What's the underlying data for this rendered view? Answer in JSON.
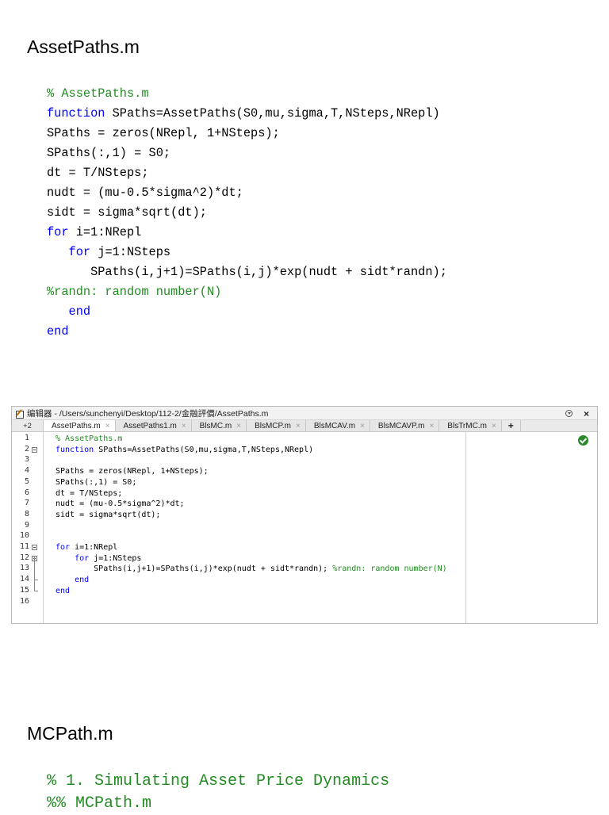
{
  "section1": {
    "heading": "AssetPaths.m"
  },
  "code1": [
    [
      {
        "t": "% AssetPaths.m",
        "c": "comment"
      }
    ],
    [
      {
        "t": "function",
        "c": "keyword"
      },
      {
        "t": " SPaths=AssetPaths(S0,mu,sigma,T,NSteps,NRepl)",
        "c": "plain"
      }
    ],
    [
      {
        "t": "SPaths = zeros(NRepl, 1+NSteps);",
        "c": "plain"
      }
    ],
    [
      {
        "t": "SPaths(:,1) = S0;",
        "c": "plain"
      }
    ],
    [
      {
        "t": "dt = T/NSteps;",
        "c": "plain"
      }
    ],
    [
      {
        "t": "nudt = (mu-0.5*sigma^2)*dt;",
        "c": "plain"
      }
    ],
    [
      {
        "t": "sidt = sigma*sqrt(dt);",
        "c": "plain"
      }
    ],
    [
      {
        "t": "for",
        "c": "keyword"
      },
      {
        "t": " i=1:NRepl",
        "c": "plain"
      }
    ],
    [
      {
        "t": "   ",
        "c": "plain"
      },
      {
        "t": "for",
        "c": "keyword"
      },
      {
        "t": " j=1:NSteps",
        "c": "plain"
      }
    ],
    [
      {
        "t": "      SPaths(i,j+1)=SPaths(i,j)*exp(nudt + sidt*randn);",
        "c": "plain"
      }
    ],
    [
      {
        "t": "%randn: random number(N)",
        "c": "comment"
      }
    ],
    [
      {
        "t": "   ",
        "c": "plain"
      },
      {
        "t": "end",
        "c": "keyword"
      }
    ],
    [
      {
        "t": "end",
        "c": "keyword"
      }
    ]
  ],
  "editor": {
    "title": "编辑器 - /Users/sunchenyi/Desktop/112-2/金融評價/AssetPaths.m",
    "tab_nav": "+2",
    "tabs": [
      {
        "label": "AssetPaths.m",
        "active": true
      },
      {
        "label": "AssetPaths1.m",
        "active": false
      },
      {
        "label": "BlsMC.m",
        "active": false
      },
      {
        "label": "BlsMCP.m",
        "active": false
      },
      {
        "label": "BlsMCAV.m",
        "active": false
      },
      {
        "label": "BlsMCAVP.m",
        "active": false
      },
      {
        "label": "BlsTrMC.m",
        "active": false
      }
    ],
    "tab_close_glyph": "×",
    "tab_add": "+",
    "line_numbers": [
      "1",
      "2",
      "3",
      "4",
      "5",
      "6",
      "7",
      "8",
      "9",
      "10",
      "11",
      "12",
      "13",
      "14",
      "15",
      "16"
    ],
    "lines": [
      [
        {
          "t": "% AssetPaths.m",
          "c": "comment"
        }
      ],
      [
        {
          "t": "function",
          "c": "keyword"
        },
        {
          "t": " SPaths=AssetPaths(S0,mu,sigma,T,NSteps,NRepl)",
          "c": "plain"
        }
      ],
      [],
      [
        {
          "t": "SPaths = zeros(NRepl, 1+NSteps);",
          "c": "plain"
        }
      ],
      [
        {
          "t": "SPaths(:,1) = S0;",
          "c": "plain"
        }
      ],
      [
        {
          "t": "dt = T/NSteps;",
          "c": "plain"
        }
      ],
      [
        {
          "t": "nudt = (mu-0.5*sigma^2)*dt;",
          "c": "plain"
        }
      ],
      [
        {
          "t": "sidt = sigma*sqrt(dt);",
          "c": "plain"
        }
      ],
      [],
      [],
      [
        {
          "t": "for",
          "c": "keyword"
        },
        {
          "t": " i=1:NRepl",
          "c": "plain"
        }
      ],
      [
        {
          "t": "    ",
          "c": "plain"
        },
        {
          "t": "for",
          "c": "keyword"
        },
        {
          "t": " j=1:NSteps",
          "c": "plain"
        }
      ],
      [
        {
          "t": "        SPaths(i,j+1)=SPaths(i,j)*exp(nudt + sidt*randn); ",
          "c": "plain"
        },
        {
          "t": "%randn: random number(N)",
          "c": "comment"
        }
      ],
      [
        {
          "t": "    ",
          "c": "plain"
        },
        {
          "t": "end",
          "c": "keyword"
        }
      ],
      [
        {
          "t": "end",
          "c": "keyword"
        }
      ],
      []
    ],
    "status_icon": "check-circle-icon"
  },
  "section2": {
    "heading": "MCPath.m"
  },
  "code2": [
    [
      {
        "t": "% 1. Simulating Asset Price Dynamics",
        "c": "comment"
      }
    ],
    [
      {
        "t": "%% MCPath.m",
        "c": "comment"
      }
    ]
  ],
  "colors": {
    "comment": "#228B22",
    "keyword": "#0000FF",
    "plain": "#000000"
  }
}
